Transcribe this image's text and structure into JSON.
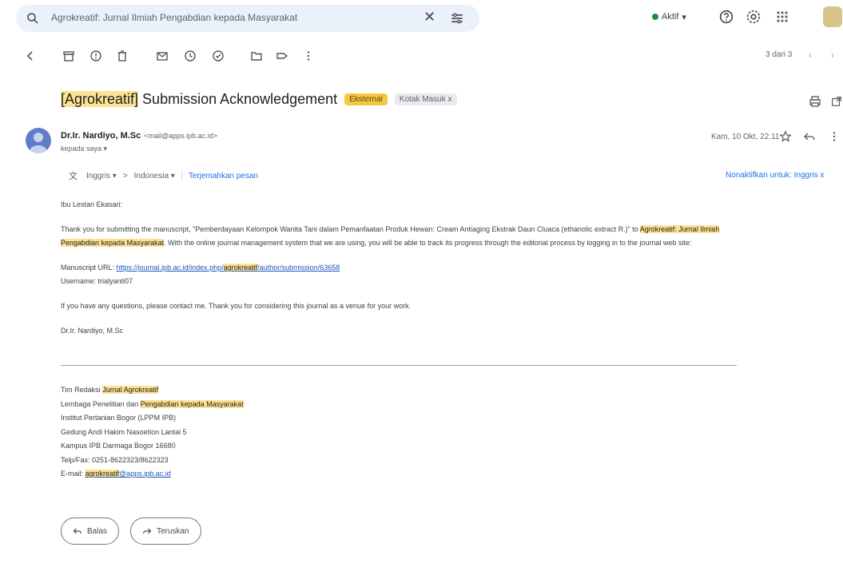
{
  "search": {
    "query": "Agrokreatif: Jurnal Ilmiah Pengabdian kepada Masyarakat"
  },
  "status": {
    "label": "Aktif"
  },
  "toolbar": {
    "pager": "3 dari 3"
  },
  "email": {
    "subject_prefix": "[Agrokreatif]",
    "subject_rest": " Submission Acknowledgement",
    "label_1": "Eksternal",
    "label_2": "Kotak Masuk x",
    "sender_name": "Dr.Ir. Nardiyo, M.Sc",
    "sender_email": "<mail@apps.ipb.ac.id>",
    "to_line": "kepada saya ▾",
    "date": "Kam, 10 Okt, 22.11",
    "translate": {
      "from": "Inggris ▾",
      "arrow": ">",
      "to": "Indonesia ▾",
      "action": "Terjemahkan pesan",
      "right": "Nonaktifkan untuk: Inggris x"
    },
    "greeting": "Ibu Lestari Ekasari:",
    "para1_a": "Thank you for submitting the manuscript, \"Pemberdayaan Kelompok Wanita Tani dalam Pemanfaatan Produk Hewan: Cream Antiaging Ekstrak Daun Cluaca",
    "para1_b": " (ethanolic extract R.)\" to ",
    "para1_hl1": "Agrokreatif: Jurnal Ilmiah",
    "para1_hl2": "Pengabdian kepada Masyarakat",
    "para1_c": ". With the online journal management system that we are using, you will be able to track its progress through the editorial process by logging in to the journal web site:",
    "manuscript_label": "Manuscript URL: ",
    "manuscript_url_a": "https://journal.ipb.ac.id/index.php/",
    "manuscript_url_hl": "agrokreatif",
    "manuscript_url_b": "/author/submission/63658",
    "username": "Username: trialyanti07",
    "para2": "If you have any questions, please contact me. Thank you for considering this journal as a venue for your work.",
    "signoff": "Dr.Ir. Nardiyo, M.Sc",
    "signature": {
      "team_prefix": "Tim Redaksi ",
      "team_hl": "Jurnal Agrokreatif",
      "inst_prefix": "Lembaga Penelitian dan ",
      "inst_hl": "Pengabdian kepada Masyarakat",
      "line3": "Institut Pertanian Bogor (LPPM IPB)",
      "line4": "Gedung Andi Hakim Nasoetion Lantai 5",
      "line5": "Kampus IPB Darmaga Bogor 16680",
      "line6": "Telp/Fax: 0251-8622323/8622323",
      "email_prefix": "E-mail: ",
      "email_hl": "agrokreatif",
      "email_rest": "@apps.ipb.ac.id"
    }
  },
  "actions": {
    "reply": "Balas",
    "forward": "Teruskan"
  }
}
